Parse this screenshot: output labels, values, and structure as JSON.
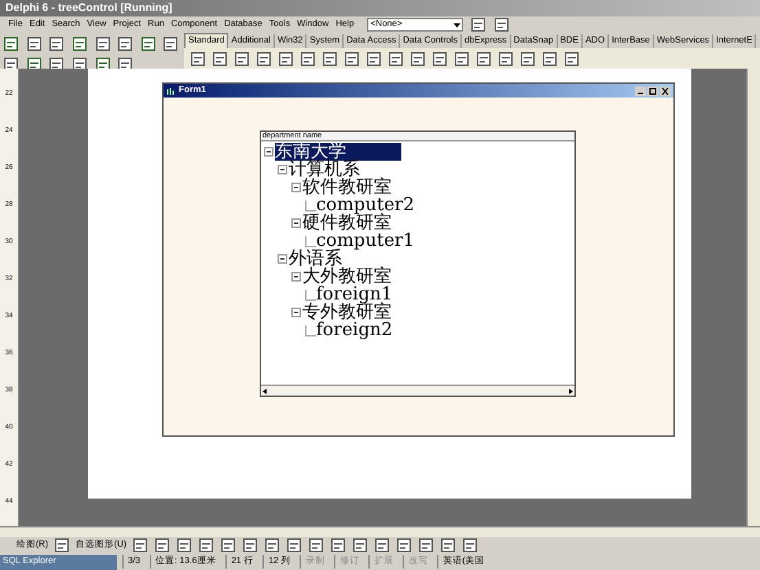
{
  "window": {
    "title": "Delphi 6 - treeControl [Running]"
  },
  "menu": [
    "File",
    "Edit",
    "Search",
    "View",
    "Project",
    "Run",
    "Component",
    "Database",
    "Tools",
    "Window",
    "Help"
  ],
  "combo": {
    "value": "<None>"
  },
  "palette_tabs": [
    {
      "label": "Standard",
      "selected": true
    },
    {
      "label": "Additional",
      "selected": false
    },
    {
      "label": "Win32",
      "selected": false
    },
    {
      "label": "System",
      "selected": false
    },
    {
      "label": "Data Access",
      "selected": false
    },
    {
      "label": "Data Controls",
      "selected": false
    },
    {
      "label": "dbExpress",
      "selected": false
    },
    {
      "label": "DataSnap",
      "selected": false
    },
    {
      "label": "BDE",
      "selected": false
    },
    {
      "label": "ADO",
      "selected": false
    },
    {
      "label": "InterBase",
      "selected": false
    },
    {
      "label": "WebServices",
      "selected": false
    },
    {
      "label": "InternetE",
      "selected": false
    }
  ],
  "ruler": [
    "22",
    "24",
    "26",
    "28",
    "30",
    "32",
    "34",
    "36",
    "38",
    "40",
    "42",
    "44"
  ],
  "form": {
    "title": "Form1",
    "tree_header": "department name",
    "tree": [
      {
        "label": "东南大学",
        "selected": true,
        "expanded": true,
        "children": [
          {
            "label": "计算机系",
            "selected": false,
            "expanded": true,
            "children": [
              {
                "label": "软件教研室",
                "selected": false,
                "expanded": true,
                "children": [
                  {
                    "label": "computer2",
                    "selected": false
                  }
                ]
              },
              {
                "label": "硬件教研室",
                "selected": false,
                "expanded": true,
                "children": [
                  {
                    "label": "computer1",
                    "selected": false
                  }
                ]
              }
            ]
          },
          {
            "label": "外语系",
            "selected": false,
            "expanded": true,
            "children": [
              {
                "label": "大外教研室",
                "selected": false,
                "expanded": true,
                "children": [
                  {
                    "label": "foreign1",
                    "selected": false
                  }
                ]
              },
              {
                "label": "专外教研室",
                "selected": false,
                "expanded": true,
                "children": [
                  {
                    "label": "foreign2",
                    "selected": false
                  }
                ]
              }
            ]
          }
        ]
      }
    ]
  },
  "drawing_toolbar": {
    "draw_menu": "绘图(R)",
    "autoshapes_menu": "自选图形(U)"
  },
  "taskbar": {
    "item": "SQL Explorer"
  },
  "status_bar": [
    "3/3",
    "位置: 13.6厘米",
    "21 行",
    "12 列",
    "录制",
    "修订",
    "扩展",
    "改写",
    "英语(美国"
  ]
}
